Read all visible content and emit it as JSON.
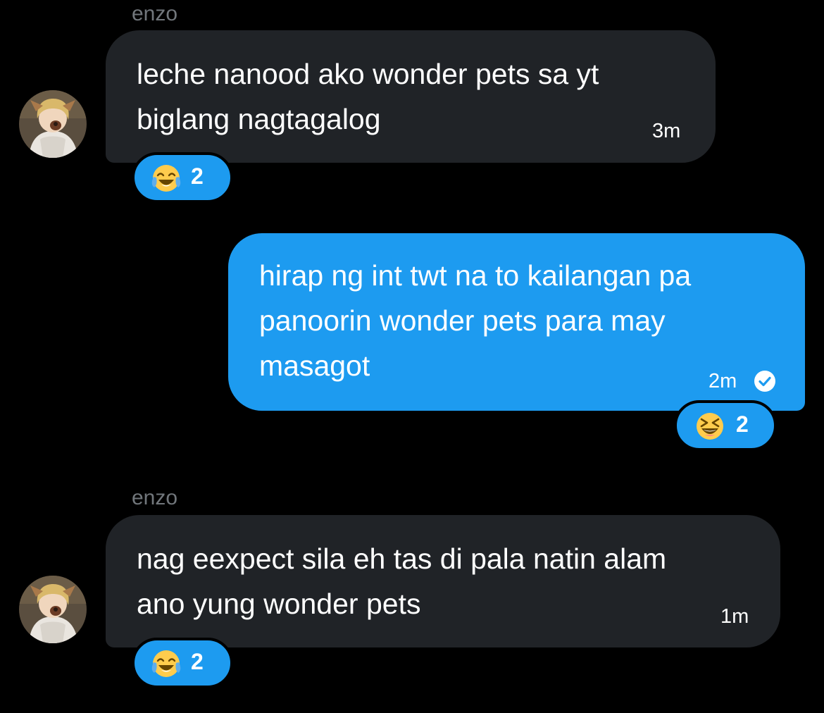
{
  "theme": {
    "background": "#000000",
    "received_bubble": "#202327",
    "sent_bubble": "#1d9bf0",
    "sender_name": "#71767b",
    "reaction_pill": "#1d9bf0"
  },
  "messages": [
    {
      "direction": "received",
      "sender": "enzo",
      "avatar_icon": "user-avatar-icon",
      "lines": [
        "leche nanood ako wonder pets sa yt",
        "biglang nagtagalog"
      ],
      "time": "3m",
      "reaction": {
        "emoji_icon": "tears-of-joy-emoji-icon",
        "count": "2"
      }
    },
    {
      "direction": "sent",
      "lines": [
        "hirap ng int twt na to kailangan pa",
        "panoorin wonder pets para may",
        "masagot"
      ],
      "time": "2m",
      "status_icon": "seen-check-icon",
      "reaction": {
        "emoji_icon": "laughing-squinting-emoji-icon",
        "count": "2"
      }
    },
    {
      "direction": "received",
      "sender": "enzo",
      "avatar_icon": "user-avatar-icon",
      "lines": [
        "nag eexpect sila eh tas di pala natin alam",
        "ano yung wonder pets"
      ],
      "time": "1m",
      "reaction": {
        "emoji_icon": "tears-of-joy-emoji-icon",
        "count": "2"
      }
    }
  ]
}
